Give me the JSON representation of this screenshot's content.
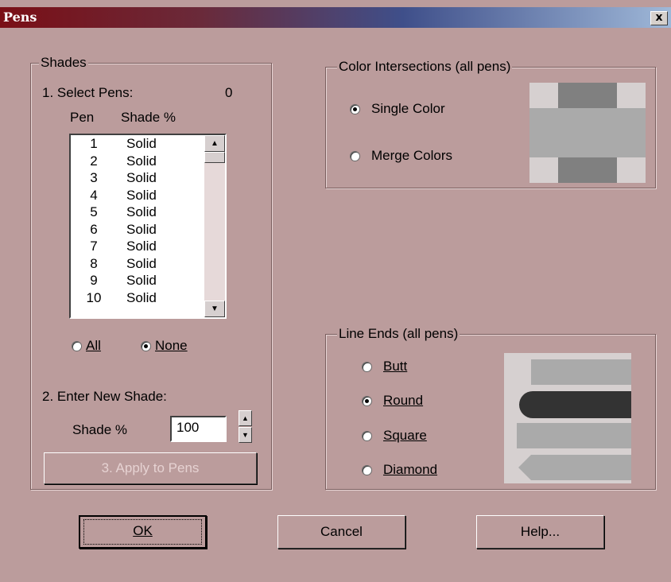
{
  "window": {
    "title": "Pens",
    "close_label": "x"
  },
  "shades": {
    "legend": "Shades",
    "select_label": "1. Select Pens:",
    "selected_count": "0",
    "col_pen": "Pen",
    "col_shade": "Shade %",
    "rows": [
      {
        "pen": "1",
        "shade": "Solid"
      },
      {
        "pen": "2",
        "shade": "Solid"
      },
      {
        "pen": "3",
        "shade": "Solid"
      },
      {
        "pen": "4",
        "shade": "Solid"
      },
      {
        "pen": "5",
        "shade": "Solid"
      },
      {
        "pen": "6",
        "shade": "Solid"
      },
      {
        "pen": "7",
        "shade": "Solid"
      },
      {
        "pen": "8",
        "shade": "Solid"
      },
      {
        "pen": "9",
        "shade": "Solid"
      },
      {
        "pen": "10",
        "shade": "Solid"
      }
    ],
    "all_label": "All",
    "none_label": "None",
    "selection_mode": "None",
    "enter_label": "2. Enter New Shade:",
    "shade_field_label": "Shade %",
    "shade_value": "100",
    "apply_label": "3. Apply to Pens"
  },
  "color_intersections": {
    "legend": "Color Intersections (all pens)",
    "single_label": "Single Color",
    "merge_label": "Merge Colors",
    "selected": "Single Color"
  },
  "line_ends": {
    "legend": "Line Ends (all pens)",
    "options": [
      "Butt",
      "Round",
      "Square",
      "Diamond"
    ],
    "selected": "Round"
  },
  "buttons": {
    "ok": "OK",
    "cancel": "Cancel",
    "help": "Help..."
  },
  "colors": {
    "dialog_bg": "#bb9c9c",
    "title_start": "#7a0f16",
    "title_end": "#9fb8d8",
    "preview_light": "#d6d0d0",
    "preview_mid": "#aaaaaa",
    "preview_dark": "#808080",
    "preview_round_cap": "#333333"
  }
}
